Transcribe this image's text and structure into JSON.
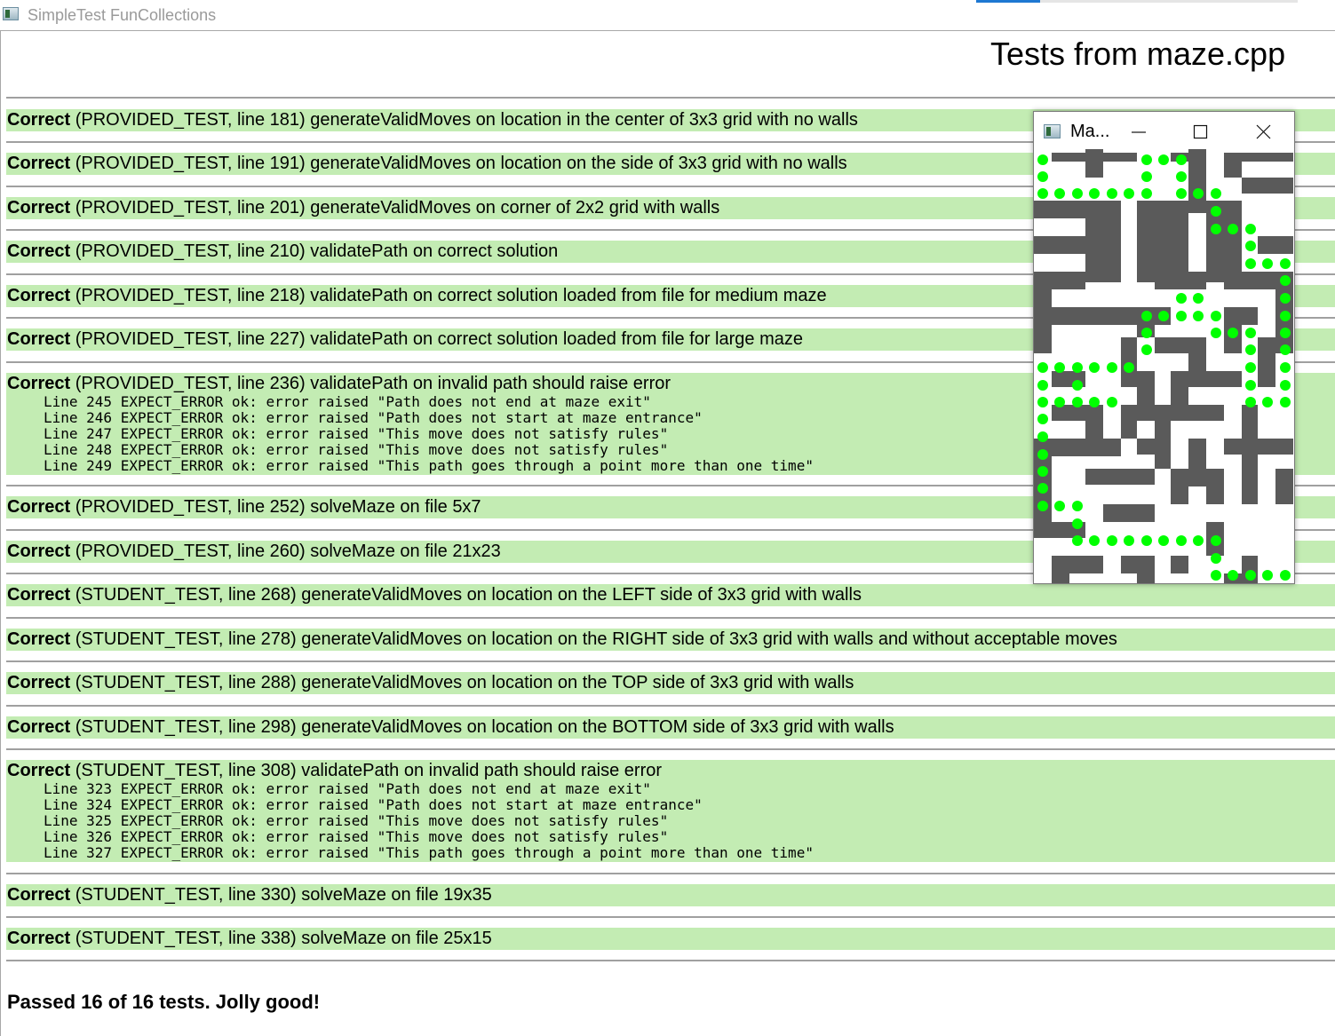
{
  "window": {
    "title": "SimpleTest FunCollections",
    "icon": "app-window-icon"
  },
  "page_title": "Tests from maze.cpp",
  "tests": [
    {
      "status": "Correct",
      "context": "(PROVIDED_TEST, line 181) generateValidMoves on location in the center of 3x3 grid with no walls",
      "details": []
    },
    {
      "status": "Correct",
      "context": "(PROVIDED_TEST, line 191) generateValidMoves on location on the side of 3x3 grid with no walls",
      "details": []
    },
    {
      "status": "Correct",
      "context": "(PROVIDED_TEST, line 201) generateValidMoves on corner of 2x2 grid with walls",
      "details": []
    },
    {
      "status": "Correct",
      "context": "(PROVIDED_TEST, line 210) validatePath on correct solution",
      "details": []
    },
    {
      "status": "Correct",
      "context": "(PROVIDED_TEST, line 218) validatePath on correct solution loaded from file for medium maze",
      "details": []
    },
    {
      "status": "Correct",
      "context": "(PROVIDED_TEST, line 227) validatePath on correct solution loaded from file for large maze",
      "details": []
    },
    {
      "status": "Correct",
      "context": "(PROVIDED_TEST, line 236) validatePath on invalid path should raise error",
      "details": [
        "Line 245 EXPECT_ERROR ok: error raised \"Path does not end at maze exit\"",
        "Line 246 EXPECT_ERROR ok: error raised \"Path does not start at maze entrance\"",
        "Line 247 EXPECT_ERROR ok: error raised \"This move does not satisfy rules\"",
        "Line 248 EXPECT_ERROR ok: error raised \"This move does not satisfy rules\"",
        "Line 249 EXPECT_ERROR ok: error raised \"This path goes through a point more than one time\""
      ]
    },
    {
      "status": "Correct",
      "context": "(PROVIDED_TEST, line 252) solveMaze on file 5x7",
      "details": []
    },
    {
      "status": "Correct",
      "context": "(PROVIDED_TEST, line 260) solveMaze on file 21x23",
      "details": []
    },
    {
      "status": "Correct",
      "context": "(STUDENT_TEST, line 268) generateValidMoves on location on the LEFT side of 3x3 grid with walls",
      "details": []
    },
    {
      "status": "Correct",
      "context": "(STUDENT_TEST, line 278) generateValidMoves on location on the RIGHT side of 3x3 grid with walls and without acceptable moves",
      "details": []
    },
    {
      "status": "Correct",
      "context": "(STUDENT_TEST, line 288) generateValidMoves on location on the TOP side of 3x3 grid with walls",
      "details": []
    },
    {
      "status": "Correct",
      "context": "(STUDENT_TEST, line 298) generateValidMoves on location on the BOTTOM side of 3x3 grid with walls",
      "details": []
    },
    {
      "status": "Correct",
      "context": "(STUDENT_TEST, line 308) validatePath on invalid path should raise error",
      "details": [
        "Line 323 EXPECT_ERROR ok: error raised \"Path does not end at maze exit\"",
        "Line 324 EXPECT_ERROR ok: error raised \"Path does not start at maze entrance\"",
        "Line 325 EXPECT_ERROR ok: error raised \"This move does not satisfy rules\"",
        "Line 326 EXPECT_ERROR ok: error raised \"This move does not satisfy rules\"",
        "Line 327 EXPECT_ERROR ok: error raised \"This path goes through a point more than one time\""
      ]
    },
    {
      "status": "Correct",
      "context": "(STUDENT_TEST, line 330) solveMaze on file 19x35",
      "details": []
    },
    {
      "status": "Correct",
      "context": "(STUDENT_TEST, line 338) solveMaze on file 25x15",
      "details": []
    }
  ],
  "summary": "Passed 16 of 16 tests. Jolly good!",
  "maze_window": {
    "title": "Ma...",
    "buttons": {
      "minimize": "minimize-icon",
      "maximize": "maximize-icon",
      "close": "close-icon"
    },
    "colors": {
      "wall": "#5a5a5a",
      "open": "#ffffff",
      "path": "#00ff00"
    }
  },
  "colors": {
    "pass_row": "#c3ecb3",
    "separator": "#a0a0a0",
    "accent_tab": "#1e78d2"
  }
}
